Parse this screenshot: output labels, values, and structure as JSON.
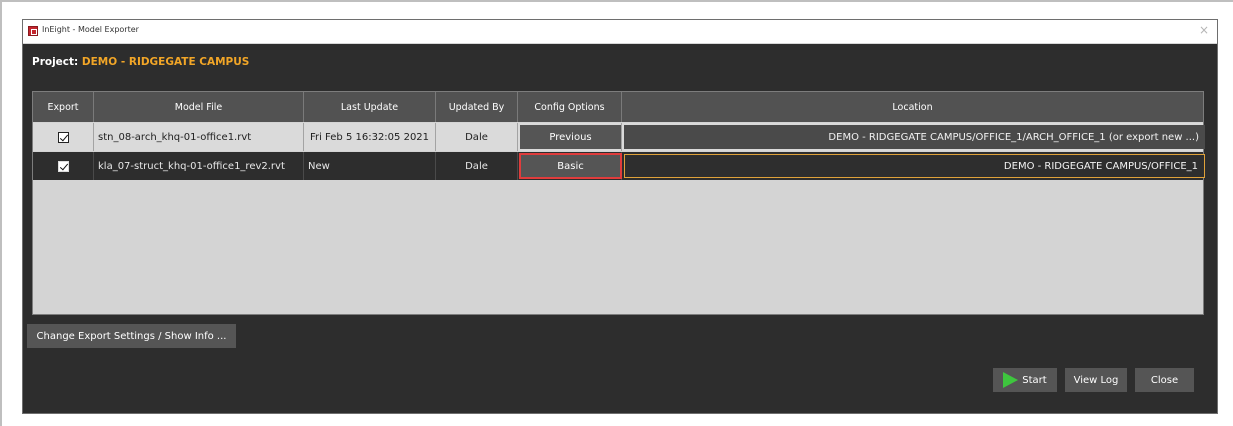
{
  "window": {
    "title": "InEight - Model Exporter",
    "close_glyph": "×"
  },
  "project": {
    "label": "Project:",
    "name": "DEMO - RIDGEGATE CAMPUS"
  },
  "table": {
    "columns": [
      "Export",
      "Model File",
      "Last Update",
      "Updated By",
      "Config Options",
      "Location"
    ],
    "rows": [
      {
        "export_checked": true,
        "model_file": "stn_08-arch_khq-01-office1.rvt",
        "last_update": "Fri Feb 5 16:32:05 2021",
        "updated_by": "Dale",
        "config_option": "Previous",
        "location": "DEMO - RIDGEGATE CAMPUS/OFFICE_1/ARCH_OFFICE_1 (or export new ...)"
      },
      {
        "export_checked": true,
        "model_file": "kla_07-struct_khq-01-office1_rev2.rvt",
        "last_update": "New",
        "updated_by": "Dale",
        "config_option": "Basic",
        "location": "DEMO - RIDGEGATE CAMPUS/OFFICE_1"
      }
    ]
  },
  "buttons": {
    "change_settings": "Change Export Settings / Show Info ...",
    "start": "Start",
    "view_log": "View Log",
    "close": "Close"
  },
  "icons": {
    "app": "ineight-app-icon",
    "start": "play-icon",
    "close": "close-icon"
  },
  "colors": {
    "project_name": "#f2a627",
    "highlight_border": "#e03c3c",
    "location_active_border": "#e0a23a",
    "start_icon": "#3ec63e"
  }
}
